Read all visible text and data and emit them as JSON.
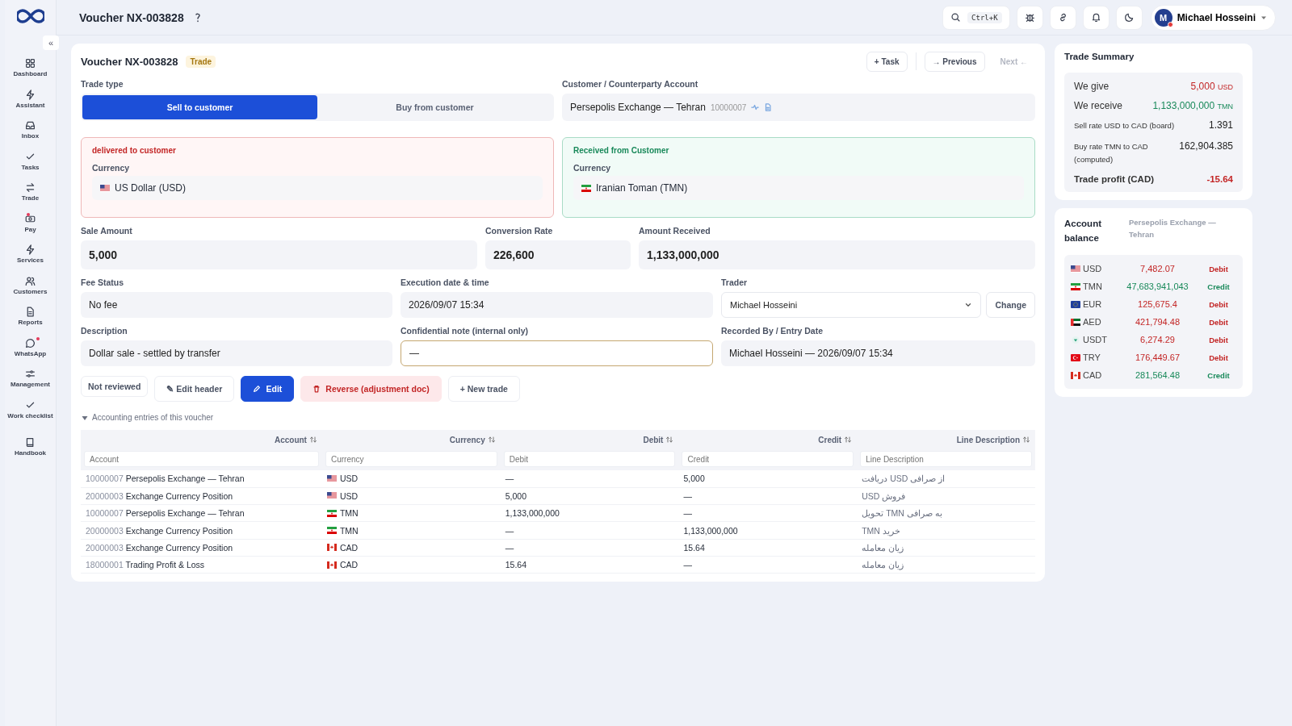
{
  "sidebar": {
    "collapse_label": "«",
    "items": [
      {
        "label": "Dashboard",
        "badge": false
      },
      {
        "label": "Assistant",
        "badge": false
      },
      {
        "label": "Inbox",
        "badge": false
      },
      {
        "label": "Tasks",
        "badge": false
      },
      {
        "label": "Trade",
        "badge": false
      },
      {
        "label": "Pay",
        "badge": true
      },
      {
        "label": "Services",
        "badge": false
      },
      {
        "label": "Customers",
        "badge": false
      },
      {
        "label": "Reports",
        "badge": false
      },
      {
        "label": "WhatsApp",
        "badge": true
      },
      {
        "label": "Management",
        "badge": false
      },
      {
        "label": "Work checklist",
        "badge": false
      },
      {
        "label": "Handbook",
        "badge": false
      }
    ]
  },
  "topbar": {
    "title": "Voucher NX-003828",
    "search_shortcut": "Ctrl+K",
    "user": {
      "initial": "M",
      "name": "Michael Hosseini",
      "online_dot": true
    }
  },
  "voucher": {
    "title": "Voucher NX-003828",
    "badge": "Trade",
    "actions": [
      {
        "label": "+ Task",
        "disabled": false
      },
      {
        "label": "→ Previous",
        "disabled": false
      },
      {
        "label": "Next ←",
        "disabled": true
      }
    ],
    "trade_type": {
      "label": "Trade type",
      "options": [
        {
          "label": "Sell to customer",
          "selected": true
        },
        {
          "label": "Buy from customer",
          "selected": false
        }
      ]
    },
    "counterparty": {
      "label": "Customer / Counterparty Account",
      "name": "Persepolis Exchange — Tehran",
      "number": "10000007"
    },
    "legs": [
      {
        "kind": "out",
        "heading": "delivered to customer",
        "label": "Currency",
        "value": "US Dollar (USD)"
      },
      {
        "kind": "in",
        "heading": "Received from Customer",
        "label": "Currency",
        "value": "Iranian Toman (TMN)"
      }
    ],
    "amounts": [
      {
        "label": "Sale Amount",
        "value": "5,000"
      },
      {
        "label": "Conversion Rate",
        "value": "226,600"
      },
      {
        "label": "Amount Received",
        "value": "1,133,000,000"
      }
    ],
    "fields": [
      {
        "kind": "text",
        "label": "Fee Status",
        "value": "No fee"
      },
      {
        "kind": "text",
        "label": "Execution date & time",
        "value": "2026/09/07 15:34"
      },
      {
        "kind": "select",
        "label": "Trader",
        "value": "Michael Hosseini",
        "button": "Change"
      },
      {
        "kind": "text",
        "label": "Description",
        "value": "Dollar sale - settled by transfer"
      },
      {
        "kind": "note",
        "label": "Confidential note (internal only)",
        "value": "—"
      },
      {
        "kind": "text",
        "label": "Recorded By / Entry Date",
        "value": "Michael Hosseini — 2026/09/07 15:34"
      }
    ],
    "buttons": [
      {
        "kind": "status",
        "label": "Not reviewed"
      },
      {
        "kind": "plain",
        "label": "✎ Edit header"
      },
      {
        "kind": "primary",
        "label": "Edit"
      },
      {
        "kind": "danger",
        "label": "Reverse (adjustment doc)"
      },
      {
        "kind": "plain",
        "label": "+ New trade"
      }
    ],
    "entries": {
      "title": "Accounting entries of this voucher",
      "expanded": true,
      "columns": [
        "Account",
        "Currency",
        "Debit",
        "Credit",
        "Line Description"
      ],
      "filters": [
        {
          "placeholder": "Account"
        },
        {
          "placeholder": "Currency"
        },
        {
          "placeholder": "Debit"
        },
        {
          "placeholder": "Credit"
        },
        {
          "placeholder": "Line Description"
        }
      ],
      "rows": [
        {
          "kind": "us",
          "number": "10000007",
          "account": "Persepolis Exchange — Tehran",
          "currency": "USD",
          "debit": "—",
          "credit": "5,000",
          "description": "از صرافی USD دریافت"
        },
        {
          "kind": "us",
          "number": "20000003",
          "account": "Exchange Currency Position",
          "currency": "USD",
          "debit": "5,000",
          "credit": "—",
          "description": "فروش USD"
        },
        {
          "kind": "ir",
          "number": "10000007",
          "account": "Persepolis Exchange — Tehran",
          "currency": "TMN",
          "debit": "1,133,000,000",
          "credit": "—",
          "description": "به صرافی TMN تحویل"
        },
        {
          "kind": "ir",
          "number": "20000003",
          "account": "Exchange Currency Position",
          "currency": "TMN",
          "debit": "—",
          "credit": "1,133,000,000",
          "description": "خرید TMN"
        },
        {
          "kind": "ca",
          "number": "20000003",
          "account": "Exchange Currency Position",
          "currency": "CAD",
          "debit": "—",
          "credit": "15.64",
          "description": "زیان معامله"
        },
        {
          "kind": "ca",
          "number": "18000001",
          "account": "Trading Profit & Loss",
          "currency": "CAD",
          "debit": "15.64",
          "credit": "—",
          "description": "زیان معامله"
        }
      ]
    }
  },
  "summary": {
    "title": "Trade Summary",
    "rows": [
      {
        "kind": "main",
        "label": "We give",
        "value": "5,000",
        "unit": "USD",
        "color": "#c32626"
      },
      {
        "kind": "main",
        "label": "We receive",
        "value": "1,133,000,000",
        "unit": "TMN",
        "color": "#19895a"
      },
      {
        "kind": "small",
        "label": "Sell rate USD to CAD (board)",
        "value": "1.391",
        "color": "#222222"
      },
      {
        "kind": "small",
        "label": "Buy rate TMN to CAD (computed)",
        "value": "162,904.385",
        "color": "#222222"
      },
      {
        "kind": "total",
        "label": "Trade profit (CAD)",
        "value": "-15.64",
        "color": "#c32626"
      }
    ]
  },
  "balance": {
    "title": "Account balance",
    "account": "Persepolis Exchange — Tehran",
    "rows": [
      {
        "kind": "us",
        "code": "USD",
        "amount": "7,482.07",
        "status": "Debit",
        "color": "#c32626"
      },
      {
        "kind": "ir",
        "code": "TMN",
        "amount": "47,683,941,043",
        "status": "Credit",
        "color": "#19895a"
      },
      {
        "kind": "eu",
        "code": "EUR",
        "amount": "125,675.4",
        "status": "Debit",
        "color": "#c32626"
      },
      {
        "kind": "ae",
        "code": "AED",
        "amount": "421,794.48",
        "status": "Debit",
        "color": "#c32626"
      },
      {
        "kind": "usdt",
        "code": "USDT",
        "amount": "6,274.29",
        "status": "Debit",
        "color": "#c32626"
      },
      {
        "kind": "tr",
        "code": "TRY",
        "amount": "176,449.67",
        "status": "Debit",
        "color": "#c32626"
      },
      {
        "kind": "ca",
        "code": "CAD",
        "amount": "281,564.48",
        "status": "Credit",
        "color": "#19895a"
      }
    ]
  }
}
